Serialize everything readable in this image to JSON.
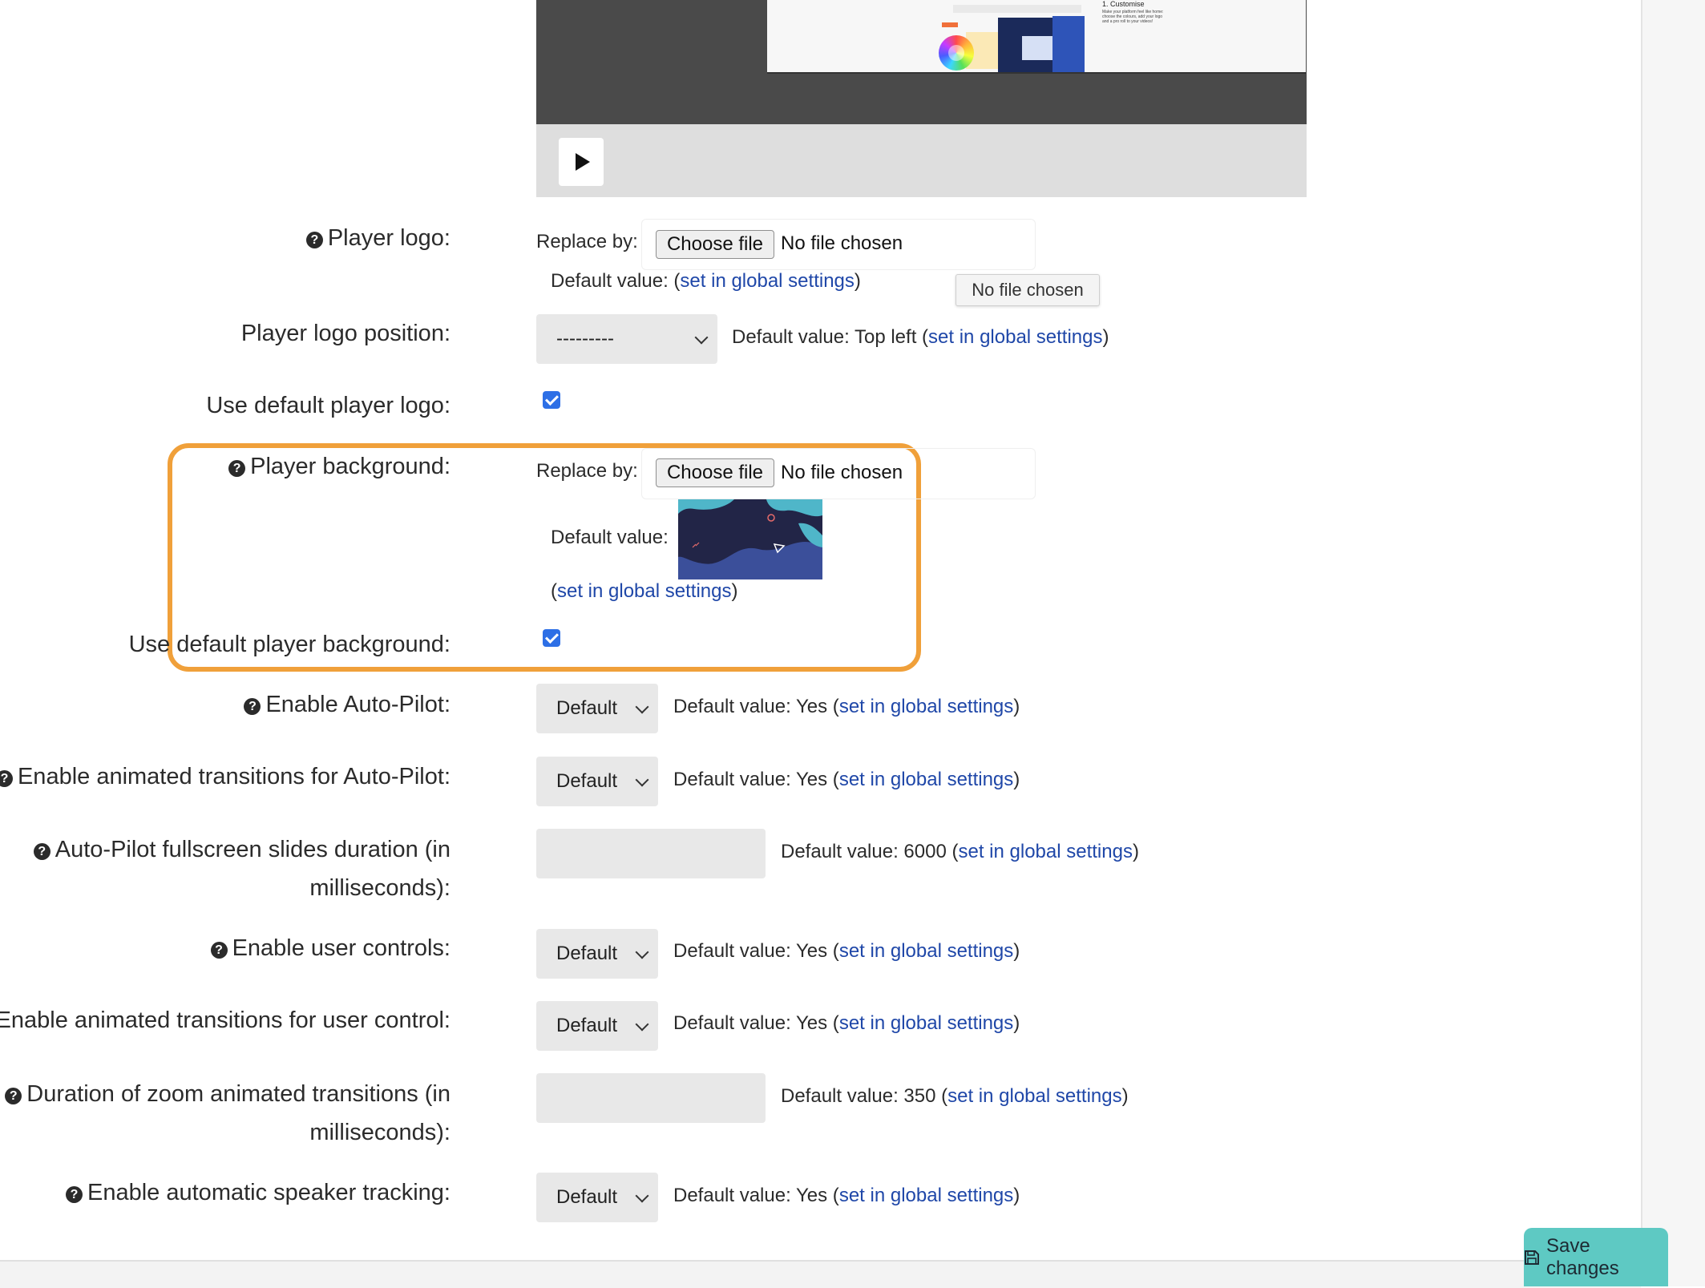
{
  "video": {
    "frame_title": "1. Customise",
    "frame_text": "Make your platform feel like home: choose the colours, add your logo and a pro roll to your videos!"
  },
  "player_logo": {
    "label": "Player logo:",
    "replace_by": "Replace by:",
    "choose_file": "Choose file",
    "no_file": "No file chosen",
    "default_prefix": "Default value: (",
    "link": "set in global settings",
    "suffix": ")",
    "tooltip": "No file chosen"
  },
  "logo_position": {
    "label": "Player logo position:",
    "value": "---------",
    "default_prefix": "Default value: Top left (",
    "link": "set in global settings",
    "suffix": ")"
  },
  "use_default_logo": {
    "label": "Use default player logo:"
  },
  "player_background": {
    "label": "Player background:",
    "replace_by": "Replace by:",
    "choose_file": "Choose file",
    "no_file": "No file chosen",
    "default_label": "Default value:",
    "link_prefix": "(",
    "link": "set in global settings",
    "suffix": ")"
  },
  "use_default_background": {
    "label": "Use default player background:"
  },
  "rows": [
    {
      "label": "Enable Auto-Pilot:",
      "value": "Default",
      "default_prefix": "Default value: Yes (",
      "link": "set in global settings",
      "suffix": ")"
    },
    {
      "label": "Enable animated transitions for Auto-Pilot:",
      "value": "Default",
      "default_prefix": "Default value: Yes (",
      "link": "set in global settings",
      "suffix": ")"
    },
    {
      "label": "Auto-Pilot fullscreen slides duration (in milliseconds):",
      "default_prefix": "Default value: 6000 (",
      "link": "set in global settings",
      "suffix": ")"
    },
    {
      "label": "Enable user controls:",
      "value": "Default",
      "default_prefix": "Default value: Yes (",
      "link": "set in global settings",
      "suffix": ")"
    },
    {
      "label": "Enable animated transitions for user control:",
      "value": "Default",
      "default_prefix": "Default value: Yes (",
      "link": "set in global settings",
      "suffix": ")"
    },
    {
      "label": "Duration of zoom animated transitions (in milliseconds):",
      "default_prefix": "Default value: 350 (",
      "link": "set in global settings",
      "suffix": ")"
    },
    {
      "label": "Enable automatic speaker tracking:",
      "value": "Default",
      "default_prefix": "Default value: Yes (",
      "link": "set in global settings",
      "suffix": ")"
    }
  ],
  "save": {
    "label": "Save changes"
  },
  "colors": {
    "highlight": "#f0a03a",
    "link": "#1f47a8",
    "checkbox": "#2d6fe6",
    "save": "#5ec9c3"
  }
}
